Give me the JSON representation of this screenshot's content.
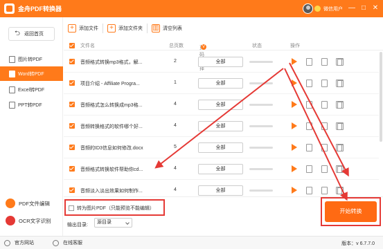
{
  "window": {
    "title": "金舟PDF转换器",
    "username": "微信用户",
    "controls": [
      "—",
      "□",
      "✕"
    ]
  },
  "sidebar": {
    "home_label": "返回首页",
    "nav": [
      {
        "label": "图片转PDF",
        "active": false
      },
      {
        "label": "Word转PDF",
        "active": true
      },
      {
        "label": "Excel转PDF",
        "active": false
      },
      {
        "label": "PPT转PDF",
        "active": false
      }
    ],
    "tools": [
      {
        "label": "PDF文件编辑",
        "color": "#ff7a1a"
      },
      {
        "label": "OCR文字识别",
        "color": "#e53935"
      }
    ]
  },
  "toolbar": {
    "add_file": "添加文件",
    "add_folder": "添加文件夹",
    "clear_list": "清空列表"
  },
  "table": {
    "columns": {
      "filename": "文件名",
      "pages": "总页数",
      "range": "页码选择",
      "range_badge": "V",
      "status": "状态",
      "actions": "操作"
    },
    "rows": [
      {
        "name": "音频格式转换mp3格式，解...",
        "pages": "2",
        "range": "全部",
        "progress": 0
      },
      {
        "name": "项目介绍 - Affiliate Progra...",
        "pages": "1",
        "range": "全部",
        "progress": 0
      },
      {
        "name": "音频格式怎么转换成mp3格...",
        "pages": "4",
        "range": "全部",
        "progress": 0
      },
      {
        "name": "音频转换格式的软件哪个好...",
        "pages": "4",
        "range": "全部",
        "progress": 0
      },
      {
        "name": "音频的ID3信息如何修改.docx",
        "pages": "5",
        "range": "全部",
        "progress": 0
      },
      {
        "name": "音频格式转换软件帮助你cd...",
        "pages": "4",
        "range": "全部",
        "progress": 0
      },
      {
        "name": "音频淡入淡出效果如何制作...",
        "pages": "4",
        "range": "全部",
        "progress": 0
      }
    ]
  },
  "bottom": {
    "option_label": "转为图片PDF（只能预览不能编辑）",
    "outdir_label": "输出目录:",
    "outdir_value": "源目录",
    "start_label": "开始转换"
  },
  "statusbar": {
    "website": "官方网站",
    "support": "在线客服",
    "version": "版本：v 6.7.7.0"
  },
  "colors": {
    "accent": "#ff7a1a",
    "annotation": "#e53935"
  }
}
